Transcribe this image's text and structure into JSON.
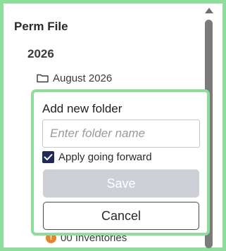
{
  "panel": {
    "title": "Perm File",
    "year": "2026",
    "folder_label": "August 2026",
    "behind_item": "00 Inventories"
  },
  "popup": {
    "title": "Add new folder",
    "input_placeholder": "Enter folder name",
    "input_value": "",
    "checkbox_label": "Apply going forward",
    "checkbox_checked": true,
    "save_label": "Save",
    "cancel_label": "Cancel"
  },
  "icons": {
    "folder": "folder-icon",
    "warning": "warning-icon",
    "check": "checkmark-icon",
    "scroll_up": "chevron-up-icon"
  },
  "colors": {
    "highlight_border": "#8fdd9c",
    "checkbox_fill": "#1f2a55",
    "save_disabled": "#cdd0d6",
    "warning": "#e8842c"
  }
}
